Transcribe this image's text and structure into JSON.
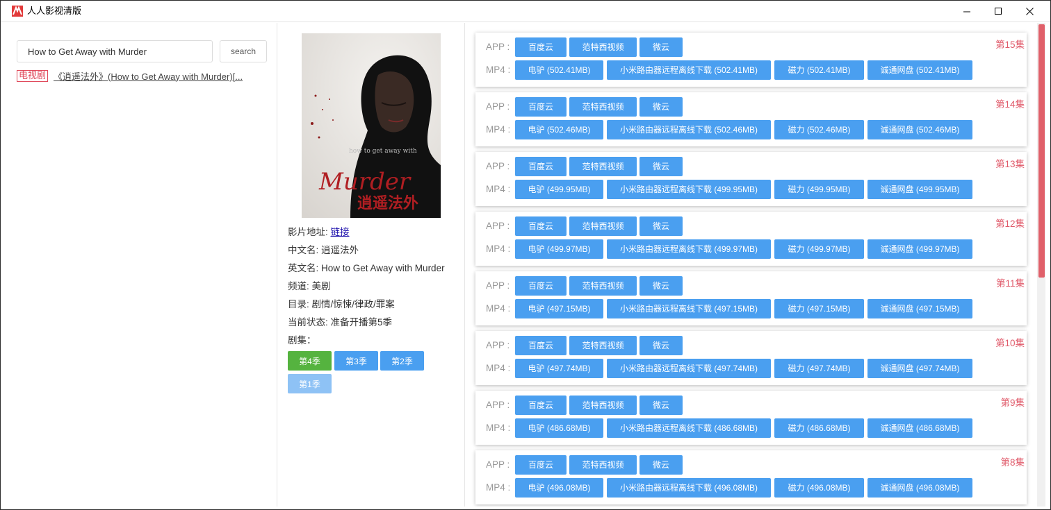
{
  "window": {
    "title": "人人影视清版"
  },
  "search": {
    "value": "How to Get Away with Murder",
    "button_label": "search"
  },
  "result": {
    "type_badge": "电视剧",
    "title": "《逍遥法外》(How to Get Away with Murder)[..."
  },
  "detail": {
    "poster_text": {
      "en_title": "how to get away with",
      "script_word": "Murder",
      "cn_title": "逍遥法外"
    },
    "url_label": "影片地址: ",
    "url_link": "链接",
    "cn_name": "中文名: 逍遥法外",
    "en_name": "英文名: How to Get Away with Murder",
    "channel": "频道: 美剧",
    "category": "目录: 剧情/惊悚/律政/罪案",
    "status": "当前状态: 准备开播第5季",
    "episodes_label": "剧集：",
    "seasons": [
      {
        "label": "第4季",
        "color": "#55b33f"
      },
      {
        "label": "第3季",
        "color": "#4a9ff0"
      },
      {
        "label": "第2季",
        "color": "#4a9ff0"
      },
      {
        "label": "第1季",
        "color": "#8ec2f5"
      }
    ]
  },
  "episodes": {
    "app_label": "APP :",
    "mp4_label": "MP4 :",
    "app_buttons": [
      "百度云",
      "范特西视频",
      "微云"
    ],
    "items": [
      {
        "title": "第15集",
        "mp4": [
          "电驴 (502.41MB)",
          "小米路由器远程离线下载 (502.41MB)",
          "磁力 (502.41MB)",
          "诚通网盘 (502.41MB)"
        ]
      },
      {
        "title": "第14集",
        "mp4": [
          "电驴 (502.46MB)",
          "小米路由器远程离线下载 (502.46MB)",
          "磁力 (502.46MB)",
          "诚通网盘 (502.46MB)"
        ]
      },
      {
        "title": "第13集",
        "mp4": [
          "电驴 (499.95MB)",
          "小米路由器远程离线下载 (499.95MB)",
          "磁力 (499.95MB)",
          "诚通网盘 (499.95MB)"
        ]
      },
      {
        "title": "第12集",
        "mp4": [
          "电驴 (499.97MB)",
          "小米路由器远程离线下载 (499.97MB)",
          "磁力 (499.97MB)",
          "诚通网盘 (499.97MB)"
        ]
      },
      {
        "title": "第11集",
        "mp4": [
          "电驴 (497.15MB)",
          "小米路由器远程离线下载 (497.15MB)",
          "磁力 (497.15MB)",
          "诚通网盘 (497.15MB)"
        ]
      },
      {
        "title": "第10集",
        "mp4": [
          "电驴 (497.74MB)",
          "小米路由器远程离线下载 (497.74MB)",
          "磁力 (497.74MB)",
          "诚通网盘 (497.74MB)"
        ]
      },
      {
        "title": "第9集",
        "mp4": [
          "电驴 (486.68MB)",
          "小米路由器远程离线下载 (486.68MB)",
          "磁力 (486.68MB)",
          "诚通网盘 (486.68MB)"
        ]
      },
      {
        "title": "第8集",
        "mp4": [
          "电驴 (496.08MB)",
          "小米路由器远程离线下载 (496.08MB)",
          "磁力 (496.08MB)",
          "诚通网盘 (496.08MB)"
        ]
      }
    ]
  },
  "scrollbar": {
    "accent": "#e0606a"
  }
}
